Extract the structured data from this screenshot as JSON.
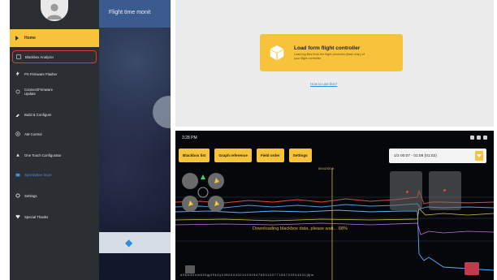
{
  "app_panel": {
    "header_title": "Flight time monit",
    "menu": {
      "active_item": "Home",
      "items": [
        {
          "label": "Blackbox Analyzer",
          "icon": "blackbox-icon",
          "highlighted": true
        },
        {
          "label": "PX Firmware Flasher",
          "icon": "flash-icon"
        },
        {
          "label": "Connect/Firmware\nUpdate",
          "icon": "link-icon"
        },
        {
          "label": "Build & Configure",
          "icon": "build-icon"
        },
        {
          "label": "AM Control",
          "icon": "control-icon"
        },
        {
          "label": "One Touch Configurator",
          "icon": "touch-icon"
        },
        {
          "label": "SpeedyBee Store",
          "icon": "store-icon",
          "blue": true
        },
        {
          "label": "Settings",
          "icon": "settings-icon"
        },
        {
          "label": "Special Thanks",
          "icon": "thanks-icon"
        }
      ]
    },
    "colors": {
      "accent": "#f6c33a",
      "drawer": "#2b2e33",
      "highlight_border": "#d83c3c"
    }
  },
  "load_panel": {
    "button_title": "Load form flight controller",
    "button_subtitle": "Load log files from the flight controller (flash chip) of your flight controller",
    "learn_more": "How to use this?"
  },
  "viewer_panel": {
    "status_time": "3:28 PM",
    "tabs": [
      "Blackbox list",
      "Graph reference",
      "Field order",
      "Settings"
    ],
    "time_range": "1/2 00:07 - 01:08 (01:02)",
    "ruler_value": "00:02:00.9",
    "download_message": "Downloading blackbox data, please wait... 68%",
    "footer": "A 3 6 m 4 b n m 6 3 0 (g 0 9 k 2 y 0 3 8 0 0 4 4 0 0 1 0 0 0 0 9 4 7 8 5 3 1 0 0 7 7 1 6 8 7 0 3 9 4 4 6 3 1 (A) m"
  }
}
